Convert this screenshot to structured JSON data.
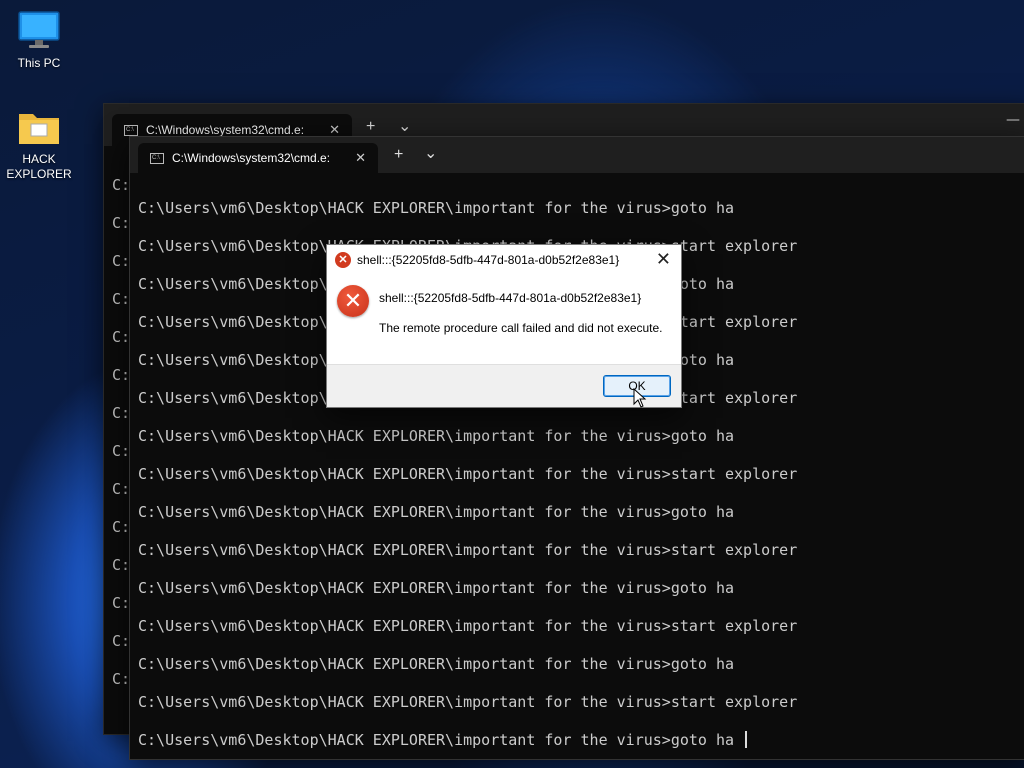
{
  "desktop": {
    "icons": [
      {
        "label": "This PC",
        "icon": "monitor-icon"
      },
      {
        "label": "HACK EXPLORER",
        "icon": "folder-icon"
      }
    ]
  },
  "back_window": {
    "tab_title": "C:\\Windows\\system32\\cmd.e:",
    "new_tab": "+",
    "dropdown": "⌄",
    "minimize": "—",
    "close_tab": "✕",
    "lines": [
      "C:",
      "C:",
      "C:",
      "C:",
      "C:",
      "C:",
      "C:",
      "C:",
      "C:",
      "C:",
      "C:",
      "C:",
      "C:",
      "C:"
    ]
  },
  "front_window": {
    "tab_title": "C:\\Windows\\system32\\cmd.e:",
    "new_tab": "+",
    "dropdown": "⌄",
    "close_tab": "✕",
    "lines": [
      "C:\\Users\\vm6\\Desktop\\HACK EXPLORER\\important for the virus>goto ha",
      "C:\\Users\\vm6\\Desktop\\HACK EXPLORER\\important for the virus>start explorer",
      "C:\\Users\\vm6\\Desktop\\HACK EXPLORER\\important for the virus>goto ha",
      "C:\\Users\\vm6\\Desktop\\HACK EXPLORER\\important for the virus>start explorer",
      "C:\\Users\\vm6\\Desktop\\HACK EXPLORER\\important for the virus>goto ha",
      "C:\\Users\\vm6\\Desktop\\HACK EXPLORER\\important for the virus>start explorer",
      "C:\\Users\\vm6\\Desktop\\HACK EXPLORER\\important for the virus>goto ha",
      "C:\\Users\\vm6\\Desktop\\HACK EXPLORER\\important for the virus>start explorer",
      "C:\\Users\\vm6\\Desktop\\HACK EXPLORER\\important for the virus>goto ha",
      "C:\\Users\\vm6\\Desktop\\HACK EXPLORER\\important for the virus>start explorer",
      "C:\\Users\\vm6\\Desktop\\HACK EXPLORER\\important for the virus>goto ha",
      "C:\\Users\\vm6\\Desktop\\HACK EXPLORER\\important for the virus>start explorer",
      "C:\\Users\\vm6\\Desktop\\HACK EXPLORER\\important for the virus>goto ha",
      "C:\\Users\\vm6\\Desktop\\HACK EXPLORER\\important for the virus>start explorer",
      "C:\\Users\\vm6\\Desktop\\HACK EXPLORER\\important for the virus>goto ha "
    ]
  },
  "dialog": {
    "title": "shell:::{52205fd8-5dfb-447d-801a-d0b52f2e83e1}",
    "heading": "shell:::{52205fd8-5dfb-447d-801a-d0b52f2e83e1}",
    "message": "The remote procedure call failed and did not execute.",
    "ok_label": "OK",
    "close": "✕",
    "icon": "error-icon"
  }
}
